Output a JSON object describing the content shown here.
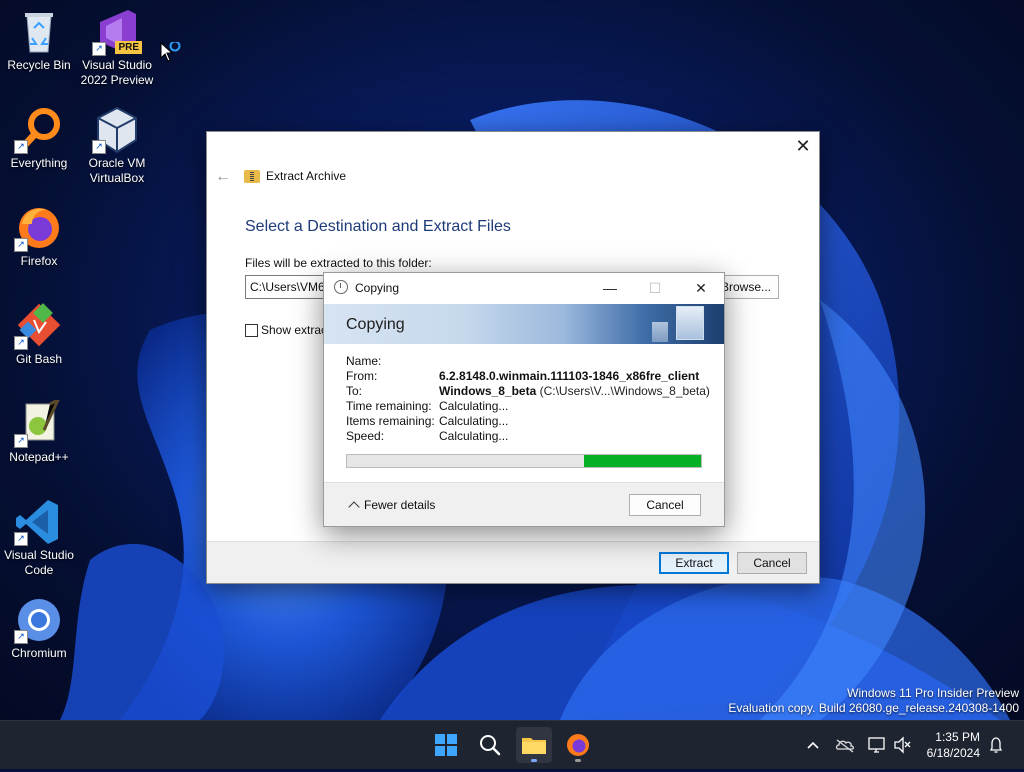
{
  "desktop": {
    "icons": [
      {
        "label": "Recycle Bin",
        "icon": "recycle-bin-icon"
      },
      {
        "label": "Visual Studio 2022 Preview",
        "icon": "visual-studio-preview-icon",
        "badge": "PRE"
      },
      {
        "label": "Everything",
        "icon": "everything-search-icon"
      },
      {
        "label": "Oracle VM VirtualBox",
        "icon": "virtualbox-icon"
      },
      {
        "label": "Firefox",
        "icon": "firefox-icon"
      },
      {
        "label": "Git Bash",
        "icon": "git-bash-icon"
      },
      {
        "label": "Notepad++",
        "icon": "notepad-plus-plus-icon"
      },
      {
        "label": "Visual Studio Code",
        "icon": "vscode-icon"
      },
      {
        "label": "Chromium",
        "icon": "chromium-icon"
      }
    ],
    "shortcut_glyph": "↗"
  },
  "extract_window": {
    "nav_title": "Extract Archive",
    "heading": "Select a Destination and Extract Files",
    "folder_label": "Files will be extracted to this folder:",
    "path_value": "C:\\Users\\VM6...",
    "browse_label": "Browse...",
    "show_files_label": "Show extracted files when complete",
    "extract_label": "Extract",
    "cancel_label": "Cancel",
    "close_glyph": "✕",
    "back_glyph": "←"
  },
  "copy_dialog": {
    "title": "Copying",
    "banner": "Copying",
    "minimize_glyph": "—",
    "maximize_glyph": "☐",
    "close_glyph": "✕",
    "rows": {
      "name_label": "Name:",
      "name_value": "",
      "from_label": "From:",
      "from_value": "6.2.8148.0.winmain.111103-1846_x86fre_client",
      "to_label": "To:",
      "to_value": "Windows_8_beta",
      "to_path": "(C:\\Users\\V...\\Windows_8_beta)",
      "time_label": "Time remaining:",
      "time_value": "Calculating...",
      "items_label": "Items remaining:",
      "items_value": "Calculating...",
      "speed_label": "Speed:",
      "speed_value": "Calculating..."
    },
    "progress_fraction": 0.33,
    "fewer_details": "Fewer details",
    "cancel_label": "Cancel"
  },
  "watermark": {
    "line1": "Windows 11 Pro Insider Preview",
    "line2": "Evaluation copy. Build 26080.ge_release.240308-1400"
  },
  "taskbar": {
    "time": "1:35 PM",
    "date": "6/18/2024"
  },
  "colors": {
    "progress": "#06b025",
    "accent": "#0078d7",
    "heading": "#1e3a78",
    "taskbar": "#1f2431"
  }
}
